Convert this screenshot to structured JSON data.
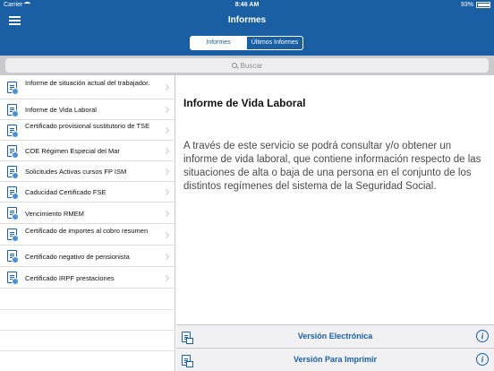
{
  "status_bar": {
    "carrier": "Carrier",
    "time": "8:46 AM",
    "battery": "93%"
  },
  "header": {
    "title": "Informes"
  },
  "tabs": [
    {
      "label": "Informes",
      "active": true
    },
    {
      "label": "Últimos Informes",
      "active": false
    }
  ],
  "search": {
    "placeholder": "Buscar"
  },
  "list": {
    "items": [
      {
        "label": "Informe de situación actual del trabajador."
      },
      {
        "label": "Informe de Vida Laboral"
      },
      {
        "label": "Certificado provisional sustitutorio de TSE"
      },
      {
        "label": "COE Régimen Especial del Mar"
      },
      {
        "label": "Solicitudes Activas cursos FP ISM"
      },
      {
        "label": "Caducidad Certificado FSE"
      },
      {
        "label": "Vencimiento RMEM"
      },
      {
        "label": "Certificado de importes al cobro resumen"
      },
      {
        "label": "Certificado negativo de pensionista"
      },
      {
        "label": "Certificado IRPF prestaciones"
      }
    ]
  },
  "detail": {
    "title": "Informe de Vida Laboral",
    "description": "A través de este servicio se podrá consultar y/o obtener un informe de vida laboral, que contiene información respecto de las situaciones de alta o baja de una persona en el conjunto de los distintos regímenes del sistema de la Seguridad Social."
  },
  "actions": [
    {
      "label": "Versión Electrónica"
    },
    {
      "label": "Versión Para Imprimir"
    }
  ],
  "colors": {
    "brand": "#1a5fa3",
    "background": "#ffffff",
    "separator": "#c8c7cc"
  },
  "icons": [
    "menu-icon",
    "wifi-icon",
    "battery-icon",
    "search-icon",
    "document-icon",
    "chevron-right-icon",
    "info-icon"
  ]
}
